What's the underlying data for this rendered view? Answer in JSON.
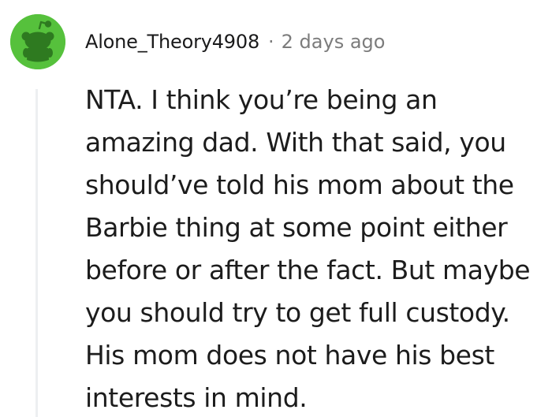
{
  "comment": {
    "avatar_icon": "reddit-snoo-icon",
    "avatar_color": "#56c13c",
    "username": "Alone_Theory4908",
    "separator": "·",
    "timestamp": "2 days ago",
    "body": "NTA. I think you’re being an amazing dad. With that said, you should’ve told his mom about the Barbie thing at some point either before or after the fact. But maybe you should try to get full custody. His mom does not have his best interests in mind."
  }
}
